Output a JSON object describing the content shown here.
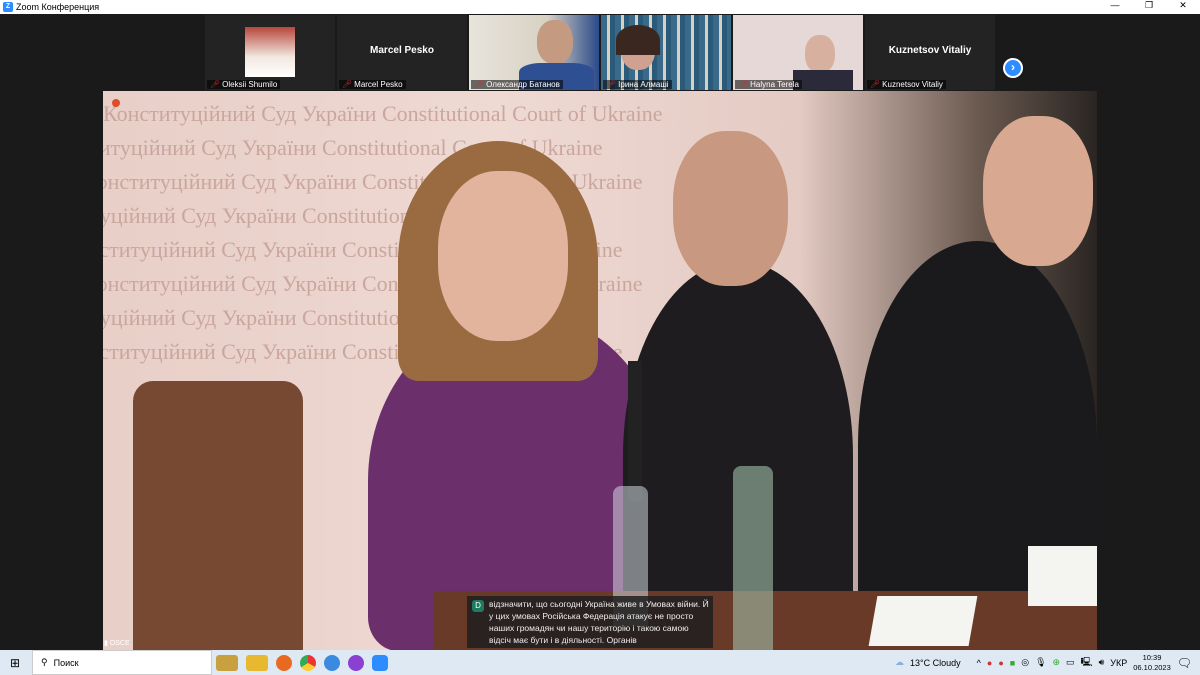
{
  "window": {
    "title": "Zoom Конференция",
    "buttons": [
      "—",
      "❐",
      "✕"
    ]
  },
  "participants": [
    {
      "name": "Oleksii Shumilo",
      "video": "photo"
    },
    {
      "name": "Marcel Pesko",
      "video": "off",
      "display": "Marcel Pesko"
    },
    {
      "name": "Олександр Батанов",
      "video": "on"
    },
    {
      "name": "Ірина Алмаші",
      "video": "on"
    },
    {
      "name": "Halyna Terela",
      "video": "on"
    },
    {
      "name": "Kuznetsov Vitaliy",
      "video": "off",
      "display": "Kuznetsov Vitaliy"
    }
  ],
  "next_label": "›",
  "video": {
    "watermark": "Конституційний Суд України Constitutional Court of Ukraine",
    "source_label": "OSCE",
    "signal_icon": "signal-bars"
  },
  "caption": {
    "speaker_initial": "D",
    "text": "відзначити, що сьогодні Україна живе в Умовах війни. Й у цих умовах Російська Федерація атакує не просто наших громадян чи нашу територію і такою самою відсіч має бути і в діяльності. Органів"
  },
  "taskbar": {
    "search_placeholder": "Поиск",
    "weather": "13°C  Cloudy",
    "language": "УКР",
    "time": "10:39",
    "date": "06.10.2023"
  }
}
